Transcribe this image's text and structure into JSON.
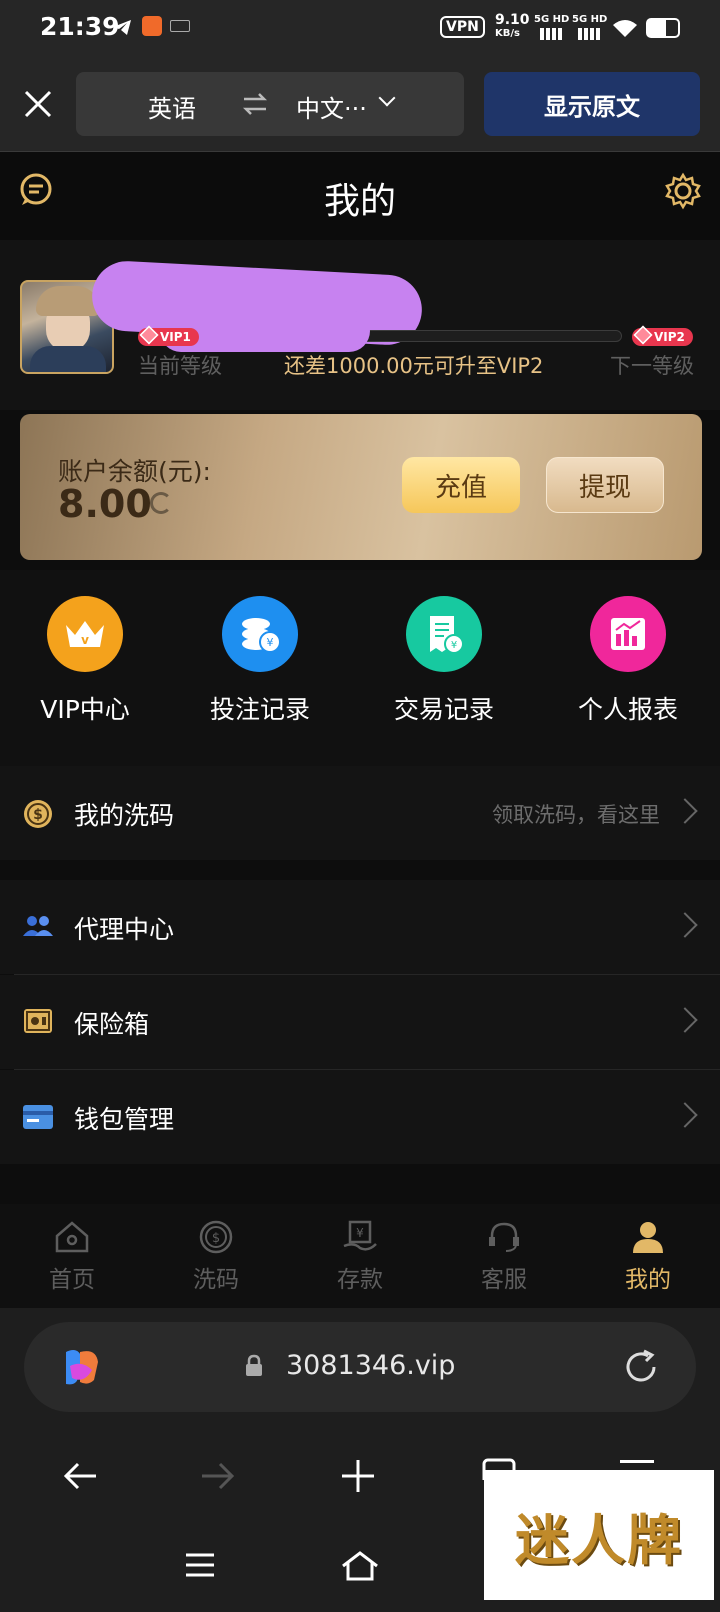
{
  "status_bar": {
    "time": "21:39",
    "vpn": "VPN",
    "speed": "9.10",
    "speed_unit": "KB/s",
    "net1": "5G HD",
    "net2": "5G HD"
  },
  "translate_bar": {
    "source_lang": "英语",
    "target_lang": "中文···",
    "show_original": "显示原文"
  },
  "header": {
    "title": "我的"
  },
  "profile": {
    "current_vip": "VIP1",
    "next_vip": "VIP2",
    "current_label": "当前等级",
    "next_label": "下一等级",
    "upgrade_text": "还差1000.00元可升至VIP2",
    "progress": 0.0
  },
  "balance": {
    "label": "账户余额(元):",
    "value": "8.00",
    "recharge": "充值",
    "withdraw": "提现"
  },
  "quick_actions": [
    {
      "label": "VIP中心",
      "icon": "crown-icon",
      "color": "#f4a21c"
    },
    {
      "label": "投注记录",
      "icon": "coins-icon",
      "color": "#1e8ff0"
    },
    {
      "label": "交易记录",
      "icon": "receipt-icon",
      "color": "#17c9a0"
    },
    {
      "label": "个人报表",
      "icon": "chart-icon",
      "color": "#f0279b"
    }
  ],
  "menu": {
    "wash": {
      "label": "我的洗码",
      "hint": "领取洗码，看这里"
    },
    "agent": {
      "label": "代理中心"
    },
    "safe": {
      "label": "保险箱"
    },
    "wallet": {
      "label": "钱包管理"
    }
  },
  "tabs": [
    {
      "label": "首页",
      "icon": "home-icon"
    },
    {
      "label": "洗码",
      "icon": "dollar-coin-icon"
    },
    {
      "label": "存款",
      "icon": "deposit-icon"
    },
    {
      "label": "客服",
      "icon": "headset-icon"
    },
    {
      "label": "我的",
      "icon": "user-icon",
      "active": true
    }
  ],
  "browser": {
    "url": "3081346.vip"
  },
  "watermark": {
    "text": "迷人牌"
  }
}
